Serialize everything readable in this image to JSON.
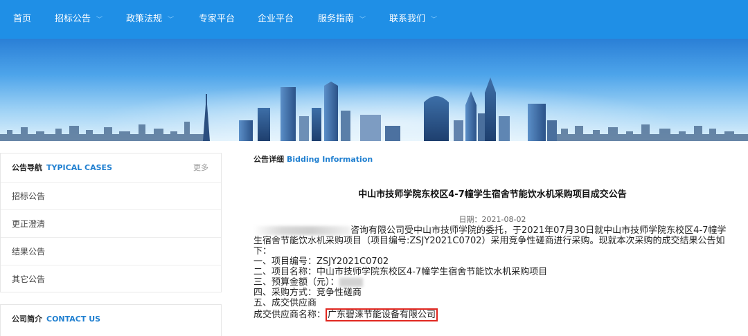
{
  "nav": {
    "items": [
      {
        "label": "首页"
      },
      {
        "label": "招标公告"
      },
      {
        "label": "政策法规"
      },
      {
        "label": "专家平台"
      },
      {
        "label": "企业平台"
      },
      {
        "label": "服务指南"
      },
      {
        "label": "联系我们"
      }
    ]
  },
  "sidebar": {
    "notice_nav": {
      "title": "公告导航",
      "title_en": "TYPICAL CASES",
      "more": "更多",
      "items": [
        "招标公告",
        "更正澄清",
        "结果公告",
        "其它公告"
      ]
    },
    "company": {
      "title": "公司简介",
      "title_en": "CONTACT US"
    }
  },
  "content": {
    "header": "公告详细",
    "header_en": "Bidding Information",
    "title": "中山市技师学院东校区4-7幢学生宿舍节能饮水机采购项目成交公告",
    "date": "日期：2021-08-02",
    "intro": "咨询有限公司受中山市技师学院的委托，于2021年07月30日就中山市技师学院东校区4-7幢学生宿舍节能饮水机采购项目（项目编号:ZSJY2021C0702）采用竞争性磋商进行采购。现就本次采购的成交结果公告如下：",
    "line1": "一、项目编号：ZSJY2021C0702",
    "line2": "二、项目名称：中山市技师学院东校区4-7幢学生宿舍节能饮水机采购项目",
    "line3": "三、预算金额（元）：",
    "line4": "四、采购方式：竞争性磋商",
    "line5": "五、成交供应商",
    "supplier_label": "成交供应商名称：",
    "supplier_name": "广东碧涞节能设备有限公司"
  },
  "colors": {
    "nav_bg": "#1f8fe6",
    "accent": "#1f7fd0",
    "highlight_border": "#e0261f"
  }
}
